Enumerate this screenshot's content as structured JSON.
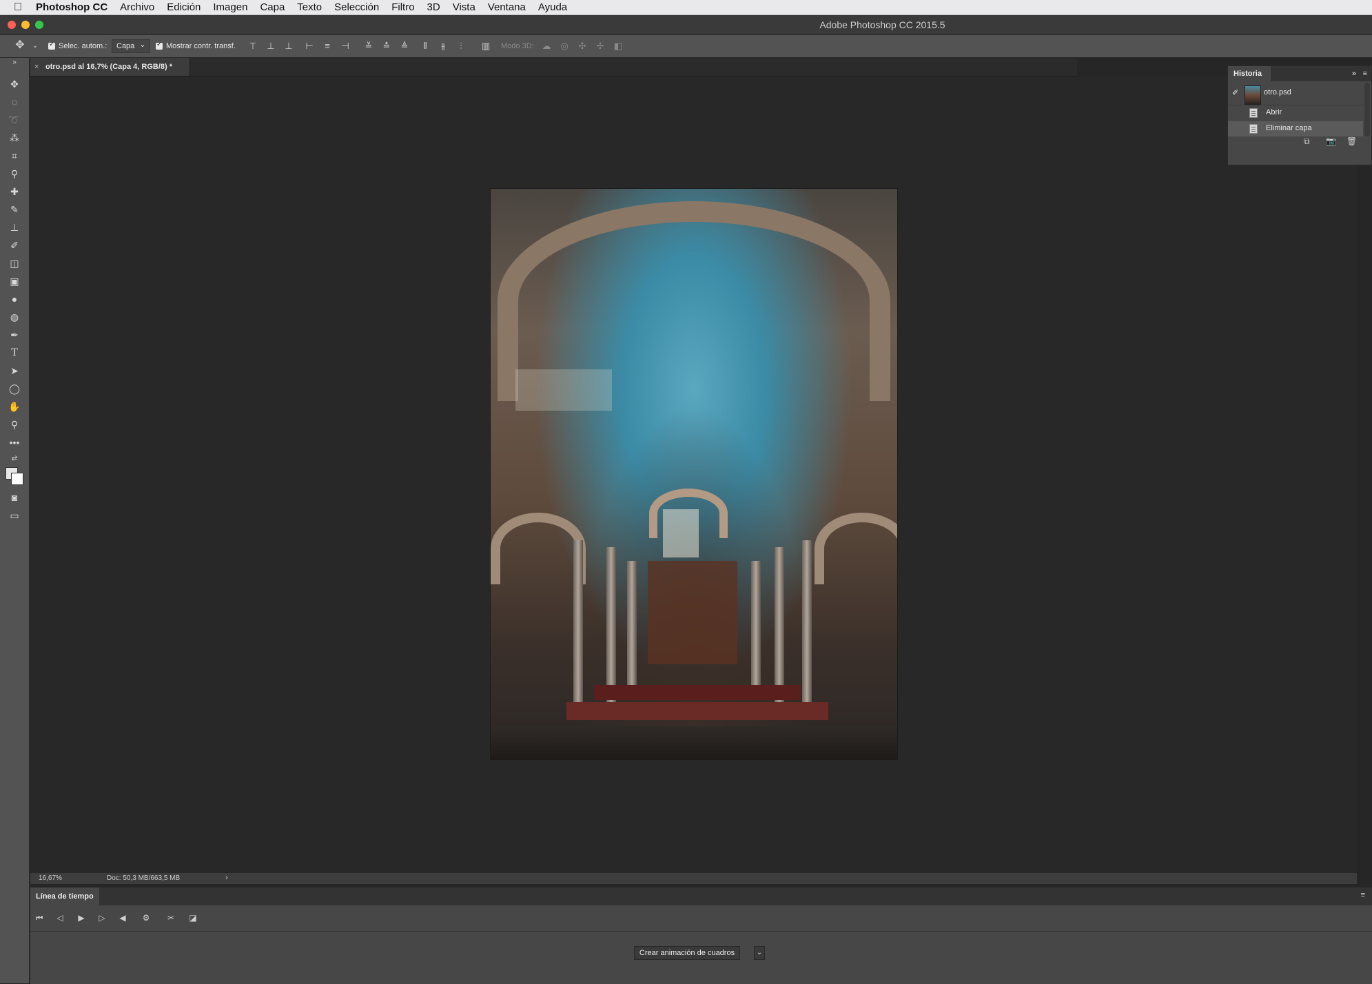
{
  "menubar": {
    "apple_icon": "apple-icon",
    "app_name": "Photoshop CC",
    "items": [
      "Archivo",
      "Edición",
      "Imagen",
      "Capa",
      "Texto",
      "Selección",
      "Filtro",
      "3D",
      "Vista",
      "Ventana",
      "Ayuda"
    ]
  },
  "window": {
    "title": "Adobe Photoshop CC 2015.5",
    "traffic_colors": [
      "#fc5f57",
      "#fdbc2e",
      "#34c84a"
    ]
  },
  "options": {
    "auto_select_label": "Selec. autom.:",
    "auto_select_value": "Capa",
    "show_transform_label": "Mostrar contr. transf.",
    "mode3d_label": "Modo 3D:"
  },
  "document": {
    "tab_label": "otro.psd al 16,7% (Capa 4, RGB/8) *",
    "close_glyph": "×"
  },
  "status": {
    "zoom": "16,67%",
    "doc_info": "Doc: 50,3 MB/663,5 MB",
    "arrow": "›"
  },
  "history": {
    "title": "Historia",
    "snapshot": "otro.psd",
    "states": [
      "Abrir",
      "Eliminar capa"
    ],
    "selected_index": 1
  },
  "timeline": {
    "title": "Línea de tiempo",
    "create_button": "Crear animación de cuadros"
  },
  "colors": {
    "menubar_bg": "#e9e9ec",
    "panel_bg": "#535353",
    "canvas_bg": "#282828",
    "selected_row": "#5a5a5a"
  }
}
